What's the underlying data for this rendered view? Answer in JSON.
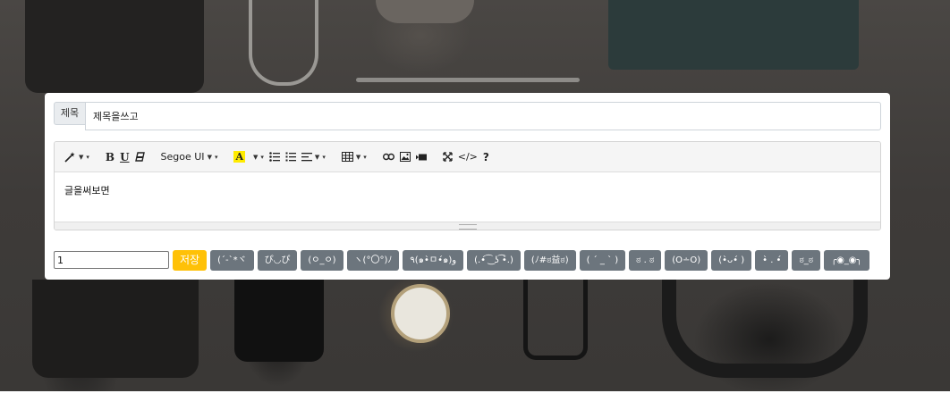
{
  "title": {
    "label": "제목",
    "value": "제목을쓰고"
  },
  "toolbar": {
    "magic_icon": "magic-wand-icon",
    "bold": "B",
    "underline": "U",
    "eraser_icon": "eraser-icon",
    "font_name": "Segoe UI",
    "color_letter": "A",
    "table_icon": "table-icon",
    "link_icon": "link-icon",
    "picture_icon": "picture-icon",
    "video_icon": "video-icon",
    "fullscreen_icon": "expand-icon",
    "code_view": "</>",
    "help": "?"
  },
  "editor": {
    "content": "글을써보면"
  },
  "footer": {
    "number_value": "1",
    "save_label": "저장",
    "emoticons": [
      "(´-`*ヾ",
      "ぴ◡ぴ",
      "(ㅇ_ㅇ)",
      "ヽ(°〇°)ﾉ",
      "٩(๑•̀ㅁ•́๑)و",
      "(.•́ ͡ ͜ ʖ ͡•̀.)",
      "(ﾉ#ಠ益ಠ)",
      "( ´ _ ` )",
      "ಠ . ಠ",
      "(O∸O)",
      "(•̀ᴗ•́ )",
      "•̀ . •́",
      "ಠ_ಠ",
      "╭◉_◉╮"
    ]
  }
}
